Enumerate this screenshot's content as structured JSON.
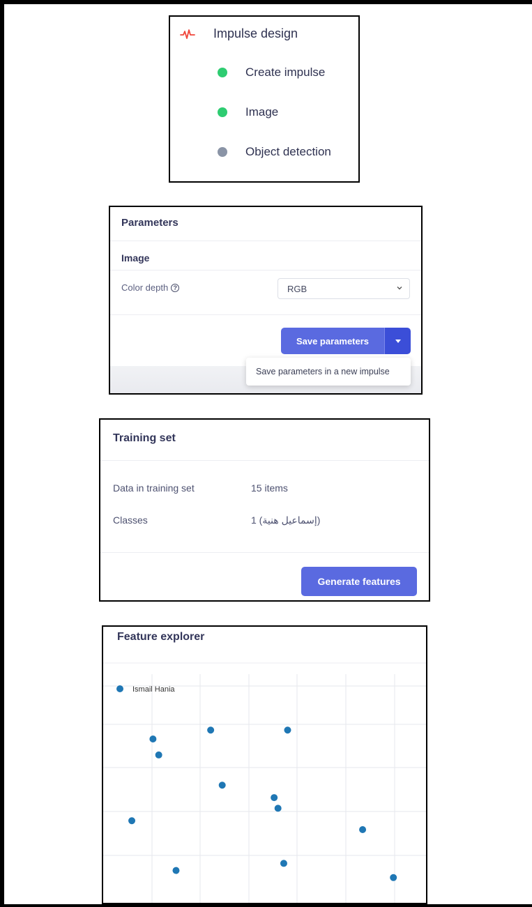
{
  "impulse_design": {
    "title": "Impulse design",
    "items": [
      {
        "label": "Create impulse",
        "status": "complete",
        "color": "#2ecc71"
      },
      {
        "label": "Image",
        "status": "complete",
        "color": "#2ecc71"
      },
      {
        "label": "Object detection",
        "status": "pending",
        "color": "#8a94a6"
      }
    ]
  },
  "parameters": {
    "title": "Parameters",
    "section": "Image",
    "color_depth_label": "Color depth",
    "color_depth_value": "RGB",
    "save_button": "Save parameters",
    "dropdown_item": "Save parameters in a new impulse"
  },
  "training_set": {
    "title": "Training set",
    "rows": [
      {
        "label": "Data in training set",
        "value": "15 items"
      },
      {
        "label": "Classes",
        "value": "1 (إسماعيل هنية)"
      }
    ],
    "generate_button": "Generate features"
  },
  "feature_explorer": {
    "title": "Feature explorer",
    "chart_data": {
      "type": "scatter",
      "series": [
        {
          "name": "Ismail Hania",
          "color": "#1f77b4",
          "points": [
            [
              0.18,
              0.73
            ],
            [
              0.78,
              0.49
            ],
            [
              0.15,
              0.82
            ],
            [
              0.45,
              0.87
            ],
            [
              0.85,
              0.87
            ],
            [
              0.51,
              0.56
            ],
            [
              0.04,
              0.36
            ],
            [
              0.8,
              0.43
            ],
            [
              1.24,
              0.31
            ],
            [
              0.27,
              0.08
            ],
            [
              0.83,
              0.12
            ],
            [
              1.4,
              0.04
            ]
          ]
        }
      ],
      "legend": "top-left",
      "grid": true
    }
  }
}
